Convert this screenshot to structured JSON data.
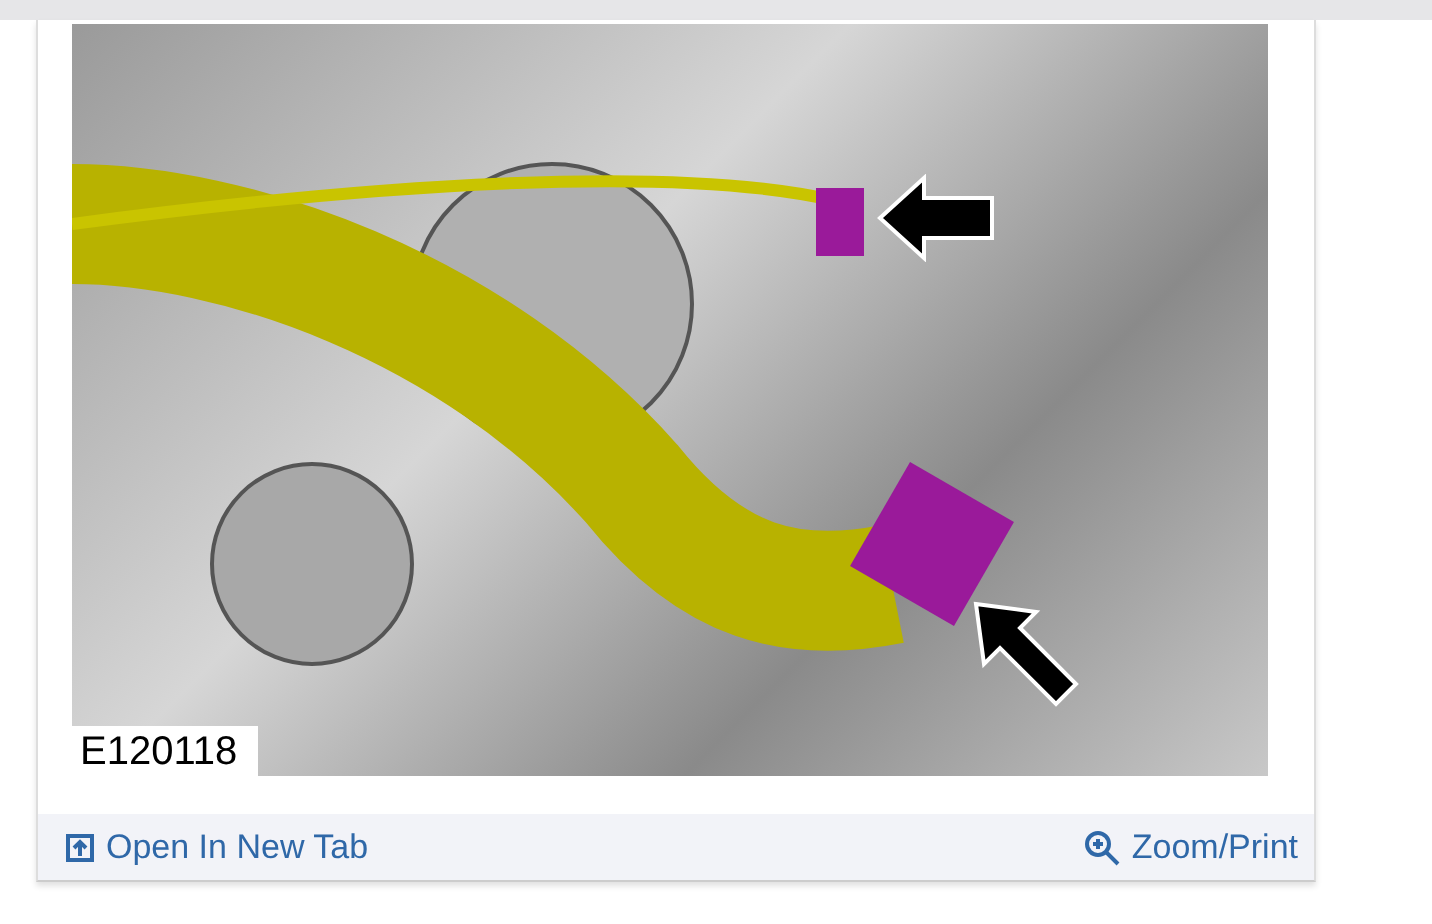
{
  "figure": {
    "label": "E120118"
  },
  "footer": {
    "open_link": "Open In New Tab",
    "zoom_link": "Zoom/Print"
  }
}
